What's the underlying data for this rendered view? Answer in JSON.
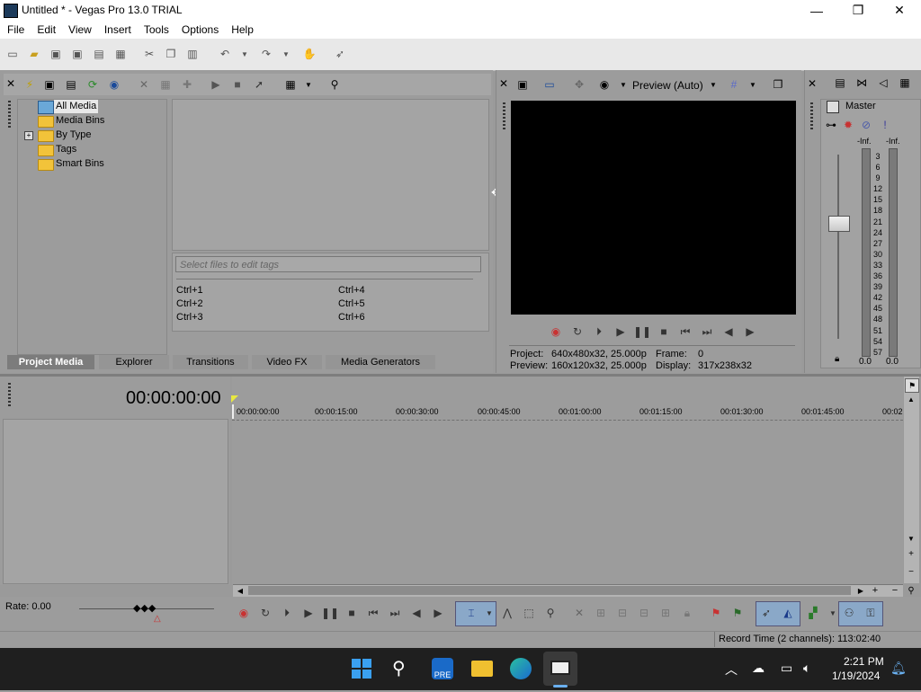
{
  "window": {
    "title": "Untitled * - Vegas Pro 13.0 TRIAL",
    "minimize": "—",
    "maximize": "❐",
    "close": "✕"
  },
  "menu": [
    "File",
    "Edit",
    "View",
    "Insert",
    "Tools",
    "Options",
    "Help"
  ],
  "project_media": {
    "tree": [
      "All Media",
      "Media Bins",
      "By Type",
      "Tags",
      "Smart Bins"
    ],
    "tags_placeholder": "Select files to edit tags",
    "shortcuts": [
      "Ctrl+1",
      "Ctrl+2",
      "Ctrl+3",
      "Ctrl+4",
      "Ctrl+5",
      "Ctrl+6"
    ]
  },
  "tabs": [
    "Project Media",
    "Explorer",
    "Transitions",
    "Video FX",
    "Media Generators"
  ],
  "preview": {
    "mode": "Preview (Auto)",
    "project_label": "Project:",
    "project_value": "640x480x32, 25.000p",
    "preview_label": "Preview:",
    "preview_value": "160x120x32, 25.000p",
    "frame_label": "Frame:",
    "frame_value": "0",
    "display_label": "Display:",
    "display_value": "317x238x32"
  },
  "mixer": {
    "title": "Master",
    "peak_left": "-Inf.",
    "peak_right": "-Inf.",
    "scale": [
      "3",
      "6",
      "9",
      "12",
      "15",
      "18",
      "21",
      "24",
      "27",
      "30",
      "33",
      "36",
      "39",
      "42",
      "45",
      "48",
      "51",
      "54",
      "57"
    ],
    "level_left": "0.0",
    "level_right": "0.0"
  },
  "timeline": {
    "timecode": "00:00:00:00",
    "ruler": [
      "00:00:00:00",
      "00:00:15:00",
      "00:00:30:00",
      "00:00:45:00",
      "00:01:00:00",
      "00:01:15:00",
      "00:01:30:00",
      "00:01:45:00",
      "00:02"
    ],
    "rate": "Rate: 0.00"
  },
  "status": {
    "record_time": "Record Time (2 channels): 113:02:40"
  },
  "taskbar": {
    "time": "2:21 PM",
    "date": "1/19/2024"
  },
  "colors": {
    "panel": "#9c9c9c",
    "preview_bg": "#000000",
    "taskbar": "#1f1f1f",
    "folder": "#f2c33a",
    "record": "#c83232"
  }
}
